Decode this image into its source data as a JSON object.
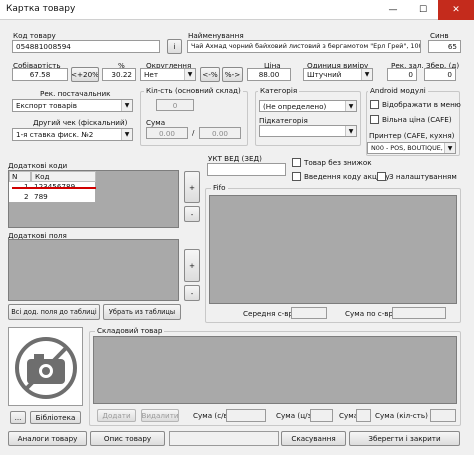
{
  "window": {
    "title": "Картка товару",
    "minimize": "—",
    "maximize": "☐",
    "close": "✕",
    "close_color": "#c42b1c"
  },
  "product": {
    "code_label": "Код товару",
    "code_value": "054881008594",
    "info_btn": "i",
    "name_label": "Найменування",
    "name_value": "Чай Ахмад чорний байховий листовий з бергамотом \"Ерл Грей\", 100 г",
    "sync_label": "Синв",
    "sync_value": "65"
  },
  "pricing": {
    "cost_label": "Собівартість",
    "cost_value": "67.58",
    "plus20_btn": "<+20%",
    "pct_label": "%",
    "pct_value": "30.22",
    "round_label": "Округлення",
    "round_value": "Нет",
    "price_minus_btn": "<-%",
    "price_plus_btn": "%->",
    "price_label": "Ціна",
    "price_value": "88.00",
    "unit_label": "Одиниця виміру",
    "unit_value": "Штучний",
    "rest_label": "Рек. зал.",
    "rest_value": "0",
    "spoil_label": "Збер. (д)",
    "spoil_value": "0"
  },
  "supplier": {
    "label": "Рек. постачальник",
    "value": "Експорт товарів",
    "check_label": "Другий чек (фіскальний)",
    "check_value": "1-я ставка фиск. №2"
  },
  "stock": {
    "title": "Кіл-сть (основний склад)",
    "qty_value": "0",
    "sum_label": "Сума",
    "sum_value1": "0.00",
    "sum_sep": "/",
    "sum_value2": "0.00"
  },
  "category": {
    "label": "Категорія",
    "value": "(Не определено)",
    "sub_label": "Підкатегорія",
    "sub_value": ""
  },
  "android": {
    "title": "Android модулі",
    "show_menu": "Відображати в меню",
    "free_price": "Вільна ціна (CAFE)",
    "printer_label": "Принтер (CAFE, кухня)",
    "printer_value": "N00 - POS, BOUTIQUE, ..."
  },
  "codes": {
    "title": "Додаткові коди",
    "col_n": "N",
    "col_code": "Код",
    "rows": [
      {
        "n": "1",
        "code": "123456789"
      },
      {
        "n": "2",
        "code": "789"
      }
    ],
    "add_btn": "+",
    "remove_btn": "-",
    "underline_color": "#d00000"
  },
  "uktzed": {
    "label": "УКТ ВЕД (ЗЕД)",
    "value": ""
  },
  "flags": {
    "no_discount": "Товар без знижок",
    "excise": "Введення коду акцизу",
    "from_settings": "З налаштуванням"
  },
  "fifo": {
    "title": "Fifo",
    "avg_label": "Середня с-врт",
    "sum_label": "Сума по с-врт"
  },
  "extra_fields": {
    "title": "Додаткові поля",
    "add_btn": "+",
    "remove_btn": "-",
    "all_to_table_btn": "Всі дод. поля до таблиці",
    "remove_from_table_btn": "Убрать из таблицы"
  },
  "composite": {
    "title": "Складовий товар",
    "add_btn": "Додати",
    "delete_btn": "Видалити",
    "cost_label": "Сума (с/в)",
    "sum_label": "Сума (ц/з)",
    "total_label": "Сума",
    "qty_label": "Сума (кіл-сть)"
  },
  "image": {
    "more_btn": "...",
    "library_btn": "Бібліотека"
  },
  "footer": {
    "analogs_btn": "Аналоги товару",
    "description_btn": "Опис товару",
    "cancel_btn": "Скасування",
    "save_close_btn": "Зберегти і закрити"
  }
}
